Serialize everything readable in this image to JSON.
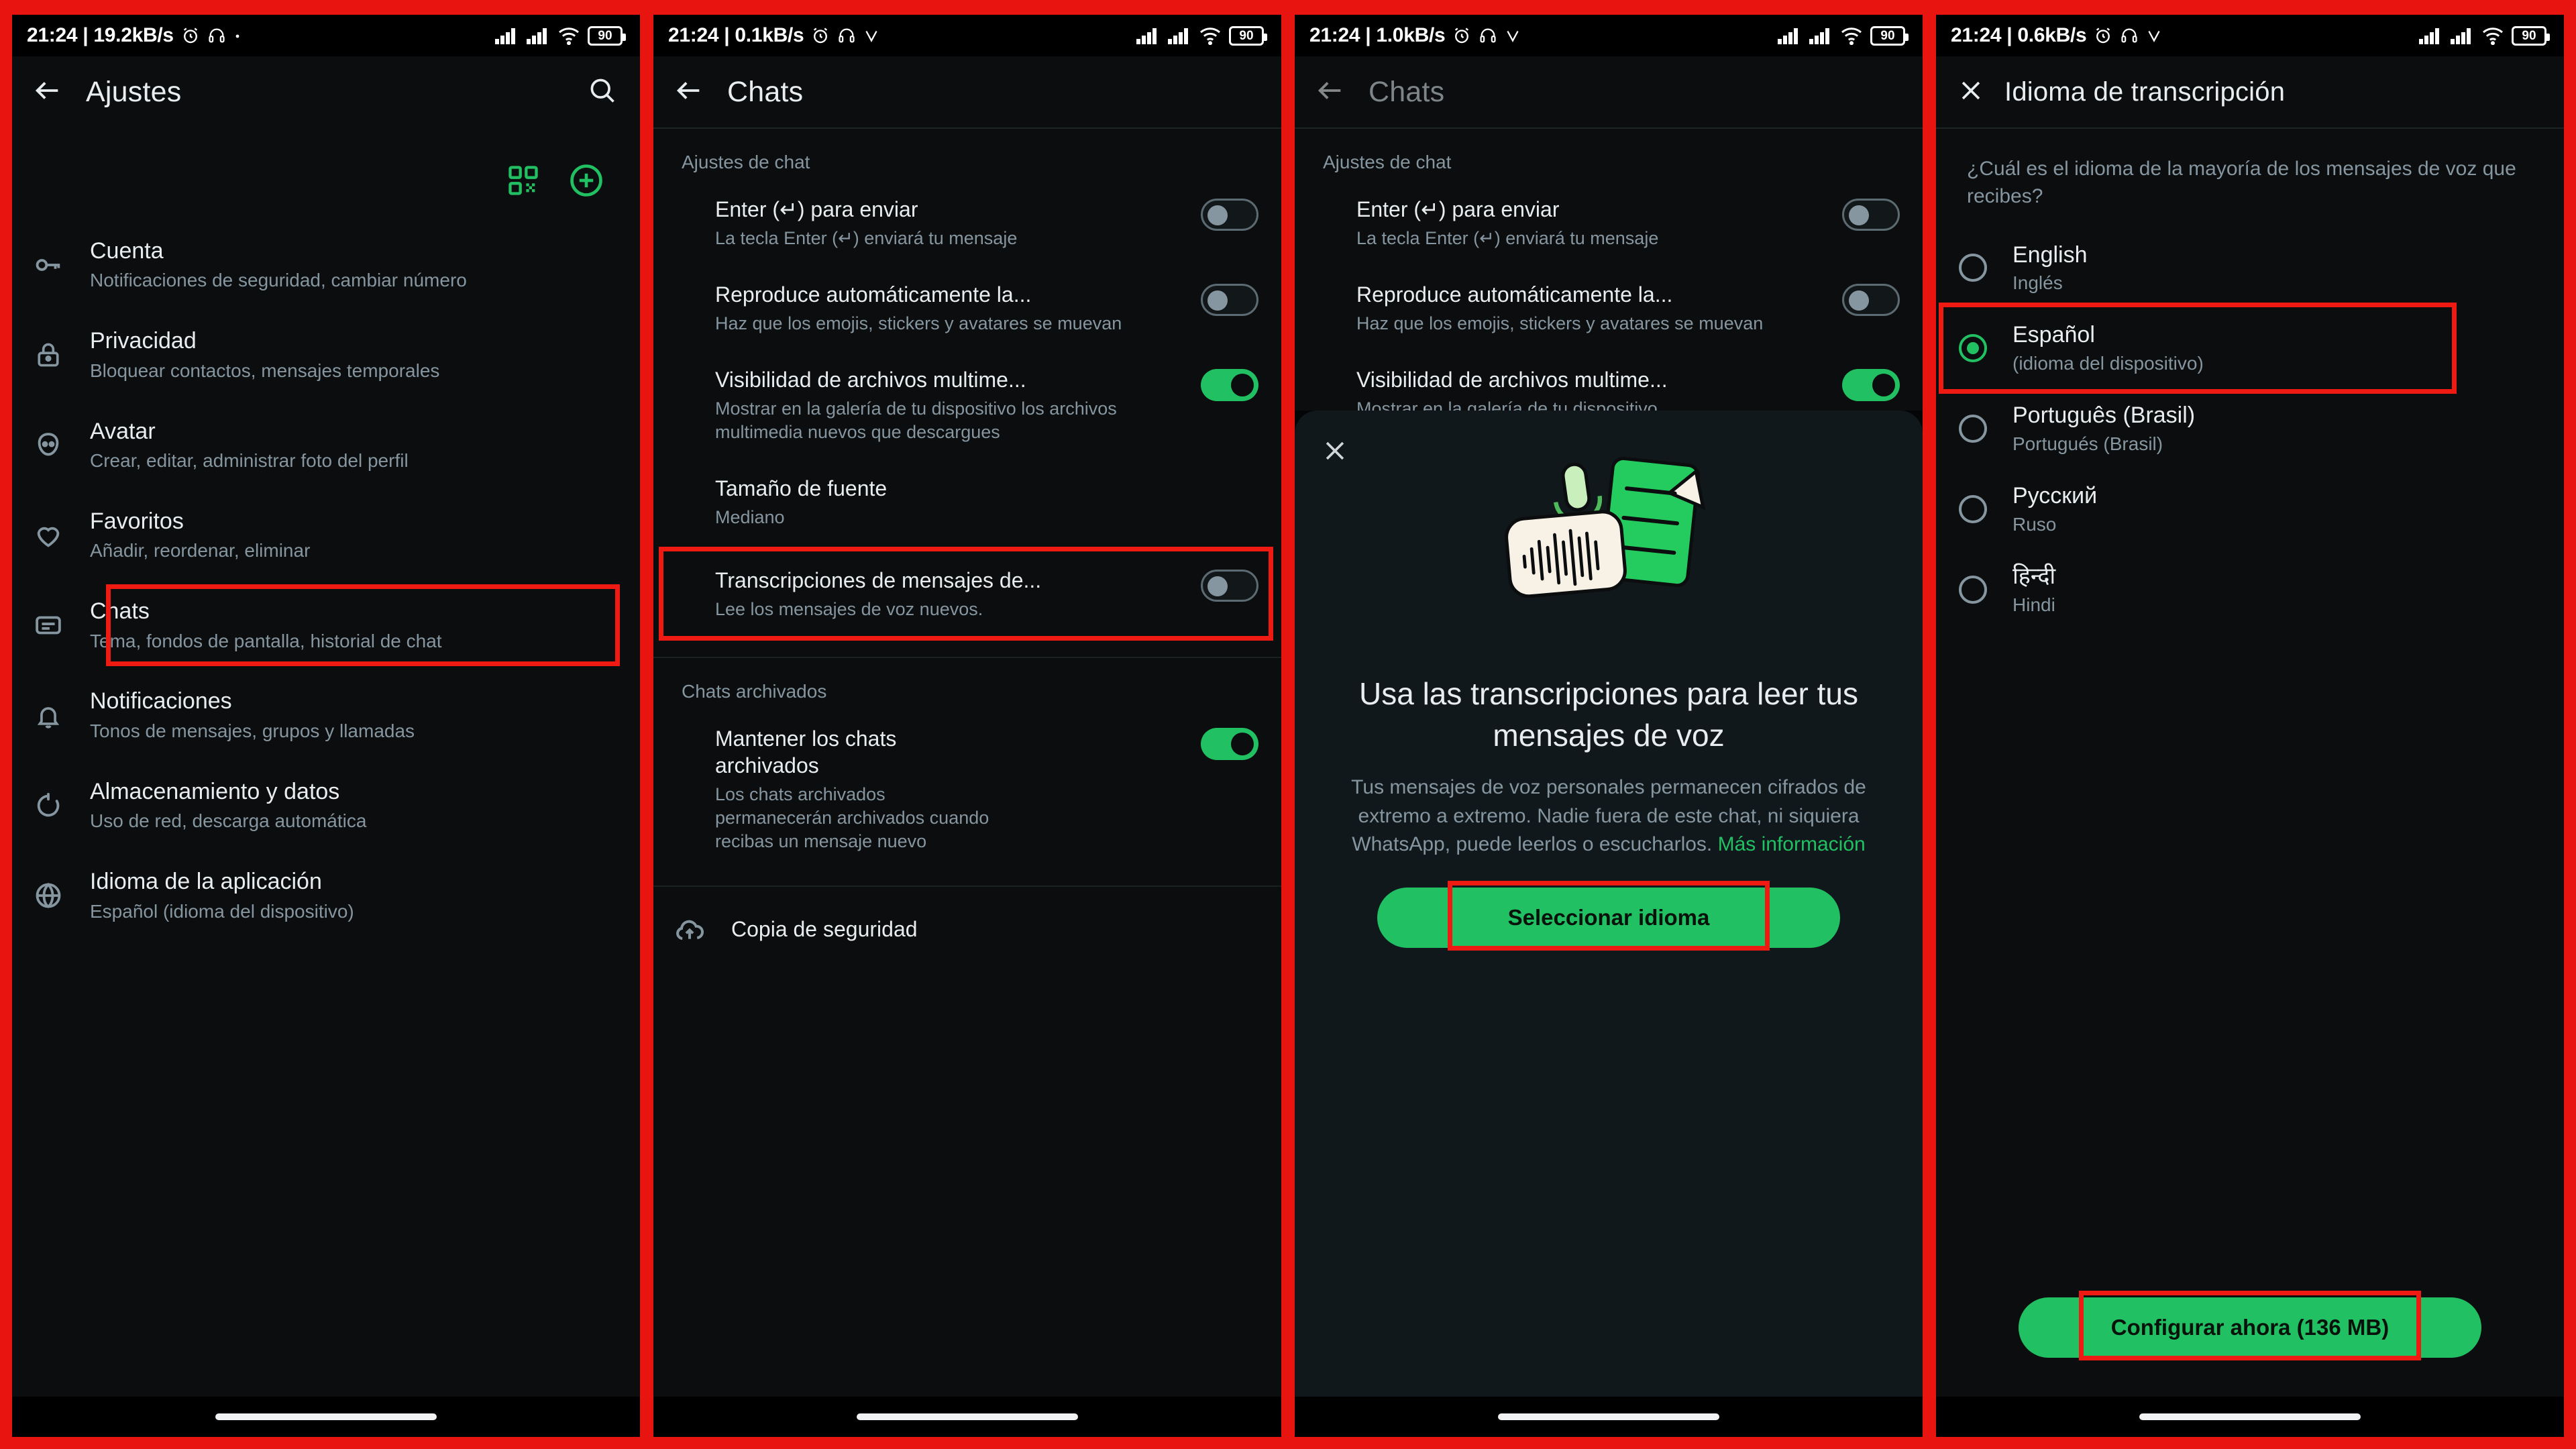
{
  "frame": {
    "accent_red": "#ef1b12",
    "brand_green": "#21c063"
  },
  "panels": [
    {
      "id": "settings",
      "statusbar": {
        "clock": "21:24 | 19.2kB/s",
        "battery": "90"
      },
      "appbar": {
        "title": "Ajustes"
      },
      "actions": {
        "qr_label": "qr-code",
        "add_label": "add"
      },
      "items": [
        {
          "icon": "key-icon",
          "title": "Cuenta",
          "subtitle": "Notificaciones de seguridad, cambiar número"
        },
        {
          "icon": "lock-icon",
          "title": "Privacidad",
          "subtitle": "Bloquear contactos, mensajes temporales"
        },
        {
          "icon": "avatar-icon",
          "title": "Avatar",
          "subtitle": "Crear, editar, administrar foto del perfil"
        },
        {
          "icon": "heart-icon",
          "title": "Favoritos",
          "subtitle": "Añadir, reordenar, eliminar"
        },
        {
          "icon": "chat-icon",
          "title": "Chats",
          "subtitle": "Tema, fondos de pantalla, historial de chat"
        },
        {
          "icon": "bell-icon",
          "title": "Notificaciones",
          "subtitle": "Tonos de mensajes, grupos y llamadas"
        },
        {
          "icon": "sync-icon",
          "title": "Almacenamiento y datos",
          "subtitle": "Uso de red, descarga automática"
        },
        {
          "icon": "globe-icon",
          "title": "Idioma de la aplicación",
          "subtitle": "Español (idioma del dispositivo)"
        }
      ]
    },
    {
      "id": "chats",
      "statusbar": {
        "clock": "21:24 | 0.1kB/s",
        "battery": "90"
      },
      "appbar": {
        "title": "Chats"
      },
      "section_chat": "Ajustes de chat",
      "section_archived": "Chats archivados",
      "toggles": [
        {
          "title": "Enter (↵) para enviar",
          "subtitle": "La tecla Enter (↵) enviará tu mensaje",
          "state": "off"
        },
        {
          "title": "Reproduce automáticamente la...",
          "subtitle": "Haz que los emojis, stickers y avatares se muevan",
          "state": "off"
        },
        {
          "title": "Visibilidad de archivos multime...",
          "subtitle": "Mostrar en la galería de tu dispositivo los archivos multimedia nuevos que descargues",
          "state": "on"
        }
      ],
      "font_size": {
        "title": "Tamaño de fuente",
        "subtitle": "Mediano"
      },
      "transcriptions": {
        "title": "Transcripciones de mensajes de...",
        "subtitle": "Lee los mensajes de voz nuevos.",
        "state": "off"
      },
      "keep_archived": {
        "title": "Mantener los chats archivados",
        "subtitle": "Los chats archivados permanecerán archivados cuando recibas un mensaje nuevo",
        "state": "on"
      },
      "backup": {
        "icon": "cloud-upload-icon",
        "title": "Copia de seguridad"
      }
    },
    {
      "id": "chats-sheet",
      "statusbar": {
        "clock": "21:24 | 1.0kB/s",
        "battery": "90"
      },
      "appbar": {
        "title": "Chats"
      },
      "section_chat": "Ajustes de chat",
      "toggles": [
        {
          "title": "Enter (↵) para enviar",
          "subtitle": "La tecla Enter (↵) enviará tu mensaje",
          "state": "off"
        },
        {
          "title": "Reproduce automáticamente la...",
          "subtitle": "Haz que los emojis, stickers y avatares se muevan",
          "state": "off"
        },
        {
          "title": "Visibilidad de archivos multime...",
          "subtitle": "Mostrar en la galería de tu dispositivo",
          "state": "on"
        }
      ],
      "sheet": {
        "close_label": "close",
        "art_label": "voice-transcription-illustration",
        "title": "Usa las transcripciones para leer tus mensajes de voz",
        "body": "Tus mensajes de voz personales permanecen cifrados de extremo a extremo. Nadie fuera de este chat, ni siquiera WhatsApp, puede leerlos o escucharlos. ",
        "link": "Más información",
        "cta": "Seleccionar idioma"
      }
    },
    {
      "id": "language",
      "statusbar": {
        "clock": "21:24 | 0.6kB/s",
        "battery": "90"
      },
      "appbar": {
        "title": "Idioma de transcripción"
      },
      "question": "¿Cuál es el idioma de la mayoría de los mensajes de voz que recibes?",
      "languages": [
        {
          "name": "English",
          "native": "Inglés",
          "selected": false
        },
        {
          "name": "Español",
          "native": "(idioma del dispositivo)",
          "selected": true
        },
        {
          "name": "Português (Brasil)",
          "native": "Portugués (Brasil)",
          "selected": false
        },
        {
          "name": "Русский",
          "native": "Ruso",
          "selected": false
        },
        {
          "name": "हिन्दी",
          "native": "Hindi",
          "selected": false
        }
      ],
      "cta": "Configurar ahora (136 MB)"
    }
  ]
}
